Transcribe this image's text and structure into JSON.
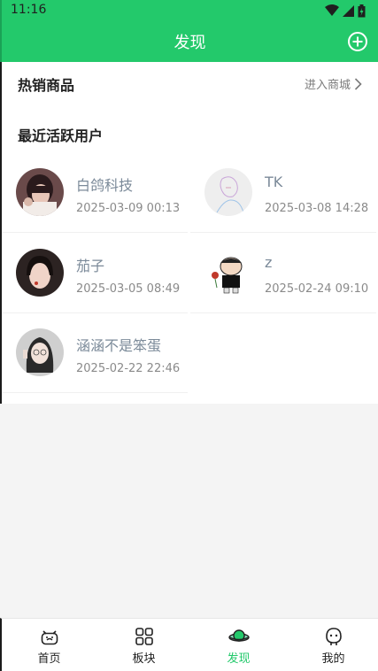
{
  "status": {
    "time": "11:16"
  },
  "header": {
    "title": "发现"
  },
  "hot": {
    "title": "热销商品",
    "link": "进入商城"
  },
  "active_users": {
    "title": "最近活跃用户",
    "users": [
      {
        "name": "白鸽科技",
        "time": "2025-03-09 00:13"
      },
      {
        "name": "TK",
        "time": "2025-03-08 14:28"
      },
      {
        "name": "茄子",
        "time": "2025-03-05 08:49"
      },
      {
        "name": "z",
        "time": "2025-02-24 09:10"
      },
      {
        "name": "涵涵不是笨蛋",
        "time": "2025-02-22 22:46"
      }
    ]
  },
  "tabs": [
    {
      "label": "首页",
      "icon": "home-face-icon"
    },
    {
      "label": "板块",
      "icon": "grid-icon"
    },
    {
      "label": "发现",
      "icon": "planet-icon",
      "active": true
    },
    {
      "label": "我的",
      "icon": "profile-face-icon"
    }
  ],
  "colors": {
    "brand": "#23c96b",
    "username": "#7b8a99"
  }
}
